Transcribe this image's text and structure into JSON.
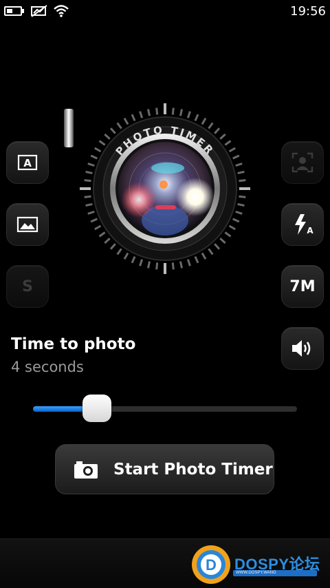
{
  "status_bar": {
    "time": "19:56",
    "icons": [
      "battery-icon",
      "mobile-data-off-icon",
      "wifi-icon"
    ]
  },
  "lens": {
    "ring_text": "PHOTO TIMER"
  },
  "left_buttons": [
    {
      "icon": "auto-mode-icon",
      "glyph": "A"
    },
    {
      "icon": "gallery-icon"
    },
    {
      "icon": "scene-mode-icon",
      "text": "S",
      "enabled": false
    }
  ],
  "right_buttons": [
    {
      "icon": "face-detection-icon",
      "enabled": false
    },
    {
      "icon": "flash-auto-icon"
    },
    {
      "icon": "resolution-icon",
      "text": "7M"
    },
    {
      "icon": "volume-icon"
    }
  ],
  "timer": {
    "title": "Time to photo",
    "value_text": "4 seconds",
    "slider_fraction": 0.21
  },
  "start_button": {
    "label": "Start Photo Timer",
    "icon": "camera-icon"
  },
  "watermark": {
    "text": "DOSPY论坛",
    "sub": "WWW.DOSPY.WANG"
  },
  "colors": {
    "accent": "#1a7ee6",
    "background": "#000000",
    "muted_text": "#9a9a9a"
  }
}
